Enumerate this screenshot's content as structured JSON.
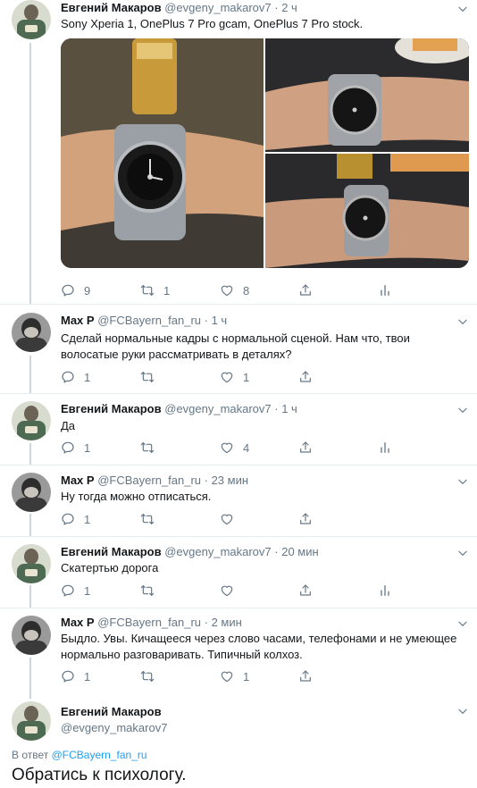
{
  "tweets": [
    {
      "name": "Евгений Макаров",
      "handle": "@evgeny_makarov7",
      "time": "2 ч",
      "text": "Sony Xperia 1, OnePlus 7 Pro gcam, OnePlus 7 Pro stock.",
      "replies": "9",
      "retweets": "1",
      "likes": "8"
    },
    {
      "name": "Max P",
      "handle": "@FCBayern_fan_ru",
      "time": "1 ч",
      "text": "Сделай нормальные кадры с нормальной сценой. Нам что, твои волосатые руки рассматривать в деталях?",
      "replies": "1",
      "retweets": "",
      "likes": "1"
    },
    {
      "name": "Евгений Макаров",
      "handle": "@evgeny_makarov7",
      "time": "1 ч",
      "text": "Да",
      "replies": "1",
      "retweets": "",
      "likes": "4"
    },
    {
      "name": "Max P",
      "handle": "@FCBayern_fan_ru",
      "time": "23 мин",
      "text": "Ну тогда можно отписаться.",
      "replies": "1",
      "retweets": "",
      "likes": ""
    },
    {
      "name": "Евгений Макаров",
      "handle": "@evgeny_makarov7",
      "time": "20 мин",
      "text": "Скатертью дорога",
      "replies": "1",
      "retweets": "",
      "likes": ""
    },
    {
      "name": "Max P",
      "handle": "@FCBayern_fan_ru",
      "time": "2 мин",
      "text": "Быдло. Увы. Кичащееся через слово часами, телефонами и не умеющее нормально разговаривать. Типичный колхоз.",
      "replies": "1",
      "retweets": "",
      "likes": "1"
    }
  ],
  "separator": " · ",
  "focused": {
    "name": "Евгений Макаров",
    "handle": "@evgeny_makarov7",
    "replying_prefix": "В ответ",
    "replying_to": "@FCBayern_fan_ru",
    "text": "Обратись к психологу."
  },
  "colors": {
    "accent": "#1da1f2",
    "secondary_text": "#657786",
    "border": "#e6ecf0",
    "thread_line": "#ccd6dd"
  },
  "icons": [
    "reply-icon",
    "retweet-icon",
    "like-icon",
    "share-icon",
    "analytics-icon",
    "chevron-down-icon"
  ]
}
